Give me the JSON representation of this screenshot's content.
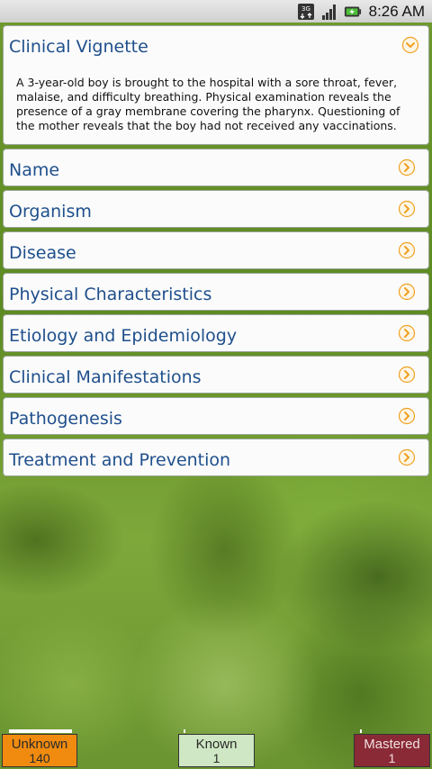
{
  "status_bar": {
    "time": "8:26 AM",
    "network_label": "3G",
    "icons": [
      "network-3g-icon",
      "signal-strength-icon",
      "battery-charging-icon"
    ]
  },
  "vignette": {
    "title": "Clinical Vignette",
    "text": "A 3-year-old boy is brought to the hospital with a sore throat, fever, malaise, and difficulty breathing. Physical examination reveals the presence of a gray membrane covering the pharynx. Questioning of the mother reveals that the boy had not received any vaccinations.",
    "expanded_icon": "chevron-down-icon"
  },
  "sections": [
    {
      "label": "Name"
    },
    {
      "label": "Organism"
    },
    {
      "label": "Disease"
    },
    {
      "label": "Physical Characteristics"
    },
    {
      "label": "Etiology and Epidemiology"
    },
    {
      "label": "Clinical Manifestations"
    },
    {
      "label": "Pathogenesis"
    },
    {
      "label": "Treatment and Prevention"
    }
  ],
  "scores": {
    "unknown": {
      "label": "Unknown",
      "count": "140",
      "color": "#f08b10"
    },
    "known": {
      "label": "Known",
      "count": "1",
      "color": "#cfe7c4"
    },
    "mastered": {
      "label": "Mastered",
      "count": "1",
      "color": "#8a2a36"
    }
  },
  "colors": {
    "accent": "#f0a020",
    "heading": "#1f4f8c"
  }
}
